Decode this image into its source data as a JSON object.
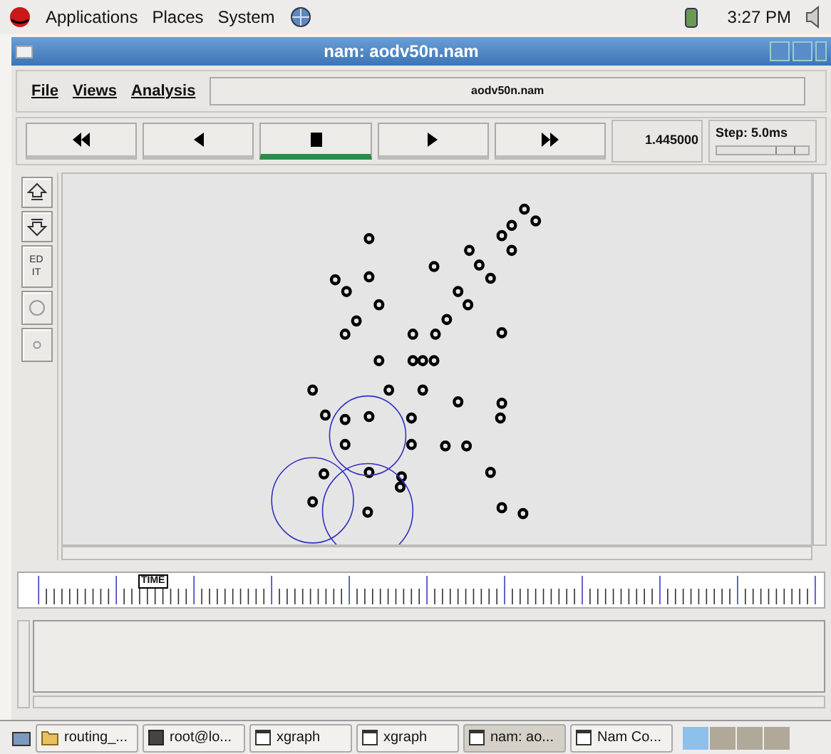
{
  "top_panel": {
    "menus": [
      "Applications",
      "Places",
      "System"
    ],
    "clock": "3:27 PM"
  },
  "window": {
    "title": "nam: aodv50n.nam"
  },
  "menu": [
    "File",
    "Views",
    "Analysis"
  ],
  "file_field": "aodv50n.nam",
  "controls": [
    {
      "kind": "rewind",
      "selected": false
    },
    {
      "kind": "back",
      "selected": false
    },
    {
      "kind": "stop",
      "selected": true
    },
    {
      "kind": "play",
      "selected": false
    },
    {
      "kind": "forward",
      "selected": false
    }
  ],
  "time": "1.445000",
  "step": {
    "label": "Step: 5.0ms",
    "level": 0.75
  },
  "side_tools": [
    {
      "kind": "zoom_in"
    },
    {
      "kind": "zoom_out"
    },
    {
      "kind": "edit",
      "lines": [
        "ED",
        "IT"
      ]
    },
    {
      "kind": "circle"
    },
    {
      "kind": "dot"
    }
  ],
  "timeline": {
    "marker": "TIME"
  },
  "taskbar": [
    {
      "label": "routing_...",
      "kind": "folder",
      "selected": false
    },
    {
      "label": "root@lo...",
      "kind": "terminal",
      "selected": false
    },
    {
      "label": "xgraph",
      "kind": "window",
      "selected": false
    },
    {
      "label": "xgraph",
      "kind": "window",
      "selected": false
    },
    {
      "label": "nam: ao...",
      "kind": "window",
      "selected": true
    },
    {
      "label": "Nam Co...",
      "kind": "window",
      "selected": false
    }
  ],
  "workspaces": [
    {
      "selected": true
    },
    {
      "selected": false
    },
    {
      "selected": false
    },
    {
      "selected": false
    }
  ]
}
